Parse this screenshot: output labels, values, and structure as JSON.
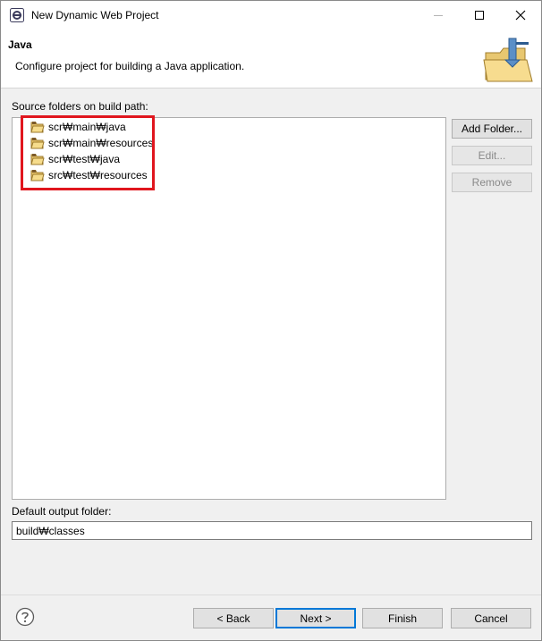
{
  "window": {
    "title": "New Dynamic Web Project",
    "icon": "eclipse-icon"
  },
  "header": {
    "title": "Java",
    "description": "Configure project for building a Java application.",
    "banner_icon": "java-folder-banner-icon"
  },
  "source_folders": {
    "label": "Source folders on build path:",
    "items": [
      {
        "label": "scr₩main₩java",
        "icon": "source-folder-icon"
      },
      {
        "label": "scr₩main₩resources",
        "icon": "source-folder-icon"
      },
      {
        "label": "scr₩test₩java",
        "icon": "source-folder-icon"
      },
      {
        "label": "src₩test₩resources",
        "icon": "source-folder-icon"
      }
    ],
    "buttons": {
      "add": "Add Folder...",
      "edit": "Edit...",
      "remove": "Remove"
    }
  },
  "output": {
    "label": "Default output folder:",
    "value": "build₩classes"
  },
  "footer": {
    "back": "< Back",
    "next": "Next >",
    "finish": "Finish",
    "cancel": "Cancel"
  },
  "colors": {
    "highlight": "#e0161e",
    "default_button_border": "#0078d7"
  }
}
